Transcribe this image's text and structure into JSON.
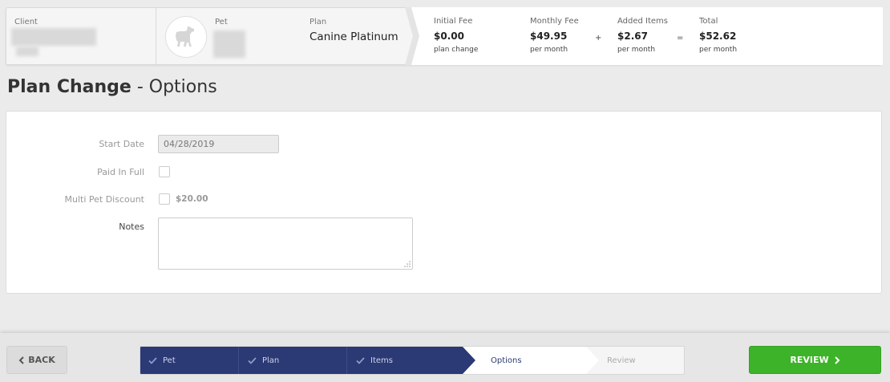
{
  "summary": {
    "client_label": "Client",
    "pet_label": "Pet",
    "plan_label": "Plan",
    "plan_name": "Canine Platinum",
    "pet_icon": "dog-icon",
    "fees": {
      "initial": {
        "label": "Initial Fee",
        "value": "$0.00",
        "sub": "plan change"
      },
      "monthly": {
        "label": "Monthly Fee",
        "value": "$49.95",
        "sub": "per month"
      },
      "added": {
        "label": "Added Items",
        "value": "$2.67",
        "sub": "per month"
      },
      "total": {
        "label": "Total",
        "value": "$52.62",
        "sub": "per month"
      },
      "plus": "+",
      "equals": "="
    }
  },
  "page": {
    "title_main": "Plan Change",
    "title_sep": " - ",
    "title_sub": "Options"
  },
  "form": {
    "start_date_label": "Start Date",
    "start_date_value": "04/28/2019",
    "paid_in_full_label": "Paid In Full",
    "multi_pet_label": "Multi Pet Discount",
    "multi_pet_amount": "$20.00",
    "notes_label": "Notes",
    "notes_value": ""
  },
  "footer": {
    "back_label": "BACK",
    "review_label": "REVIEW",
    "steps": [
      {
        "label": "Pet",
        "state": "done"
      },
      {
        "label": "Plan",
        "state": "done"
      },
      {
        "label": "Items",
        "state": "done"
      },
      {
        "label": "Options",
        "state": "active"
      },
      {
        "label": "Review",
        "state": "pending"
      }
    ],
    "colors": {
      "wizard_done": "#2b3a75",
      "review_button": "#3db329"
    }
  }
}
